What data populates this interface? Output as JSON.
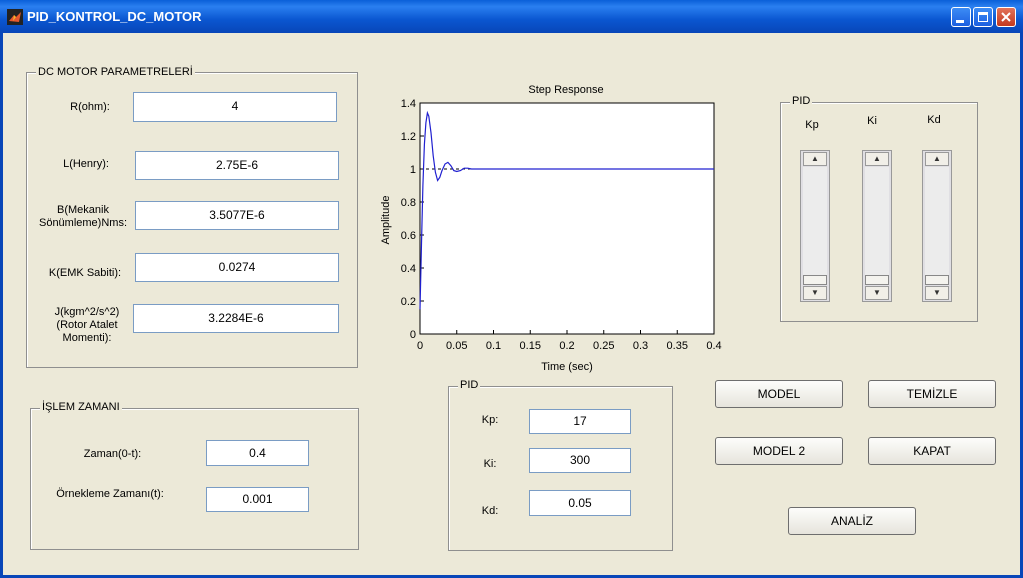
{
  "window": {
    "title": "PID_KONTROL_DC_MOTOR"
  },
  "motor_params": {
    "legend": "DC MOTOR PARAMETRELERİ",
    "rows": [
      {
        "label": "R(ohm):",
        "value": "4"
      },
      {
        "label": "L(Henry):",
        "value": "2.75E-6"
      },
      {
        "label": "B(Mekanik Sönümleme)Nms:",
        "value": "3.5077E-6"
      },
      {
        "label": "K(EMK Sabiti):",
        "value": "0.0274"
      },
      {
        "label": "J(kgm^2/s^2) (Rotor Atalet Momenti):",
        "value": "3.2284E-6"
      }
    ]
  },
  "time_panel": {
    "legend": "İŞLEM ZAMANI",
    "time_label": "Zaman(0-t):",
    "time_value": "0.4",
    "sample_label": "Örnekleme Zamanı(t):",
    "sample_value": "0.001"
  },
  "pid_inputs": {
    "legend": "PID",
    "kp_label": "Kp:",
    "kp_value": "17",
    "ki_label": "Ki:",
    "ki_value": "300",
    "kd_label": "Kd:",
    "kd_value": "0.05"
  },
  "pid_sliders": {
    "legend": "PID",
    "labels": [
      "Kp",
      "Ki",
      "Kd"
    ],
    "levels": [
      0.0,
      0.0,
      0.0
    ]
  },
  "buttons": {
    "model": "MODEL",
    "temizle": "TEMİZLE",
    "model2": "MODEL 2",
    "kapat": "KAPAT",
    "analiz": "ANALİZ"
  },
  "chart_data": {
    "type": "line",
    "title": "Step Response",
    "xlabel": "Time (sec)",
    "ylabel": "Amplitude",
    "xlim": [
      0,
      0.4
    ],
    "ylim": [
      0,
      1.4
    ],
    "xticks": [
      "0",
      "0.05",
      "0.1",
      "0.15",
      "0.2",
      "0.25",
      "0.3",
      "0.35",
      "0.4"
    ],
    "yticks": [
      "0",
      "0.2",
      "0.4",
      "0.6",
      "0.8",
      "1",
      "1.2",
      "1.4"
    ],
    "series": [
      {
        "x": [
          0,
          0.002,
          0.004,
          0.006,
          0.008,
          0.01,
          0.012,
          0.015,
          0.018,
          0.021,
          0.024,
          0.027,
          0.03,
          0.034,
          0.038,
          0.042,
          0.046,
          0.05,
          0.055,
          0.06,
          0.065,
          0.07,
          0.08,
          0.09,
          0.1,
          0.13,
          0.2,
          0.3,
          0.4
        ],
        "y": [
          0.15,
          0.55,
          0.9,
          1.15,
          1.28,
          1.34,
          1.32,
          1.22,
          1.08,
          0.98,
          0.93,
          0.95,
          0.99,
          1.03,
          1.04,
          1.02,
          0.99,
          0.985,
          0.99,
          1.005,
          1.005,
          1.0,
          1.0,
          1.0,
          1.0,
          1.0,
          1.0,
          1.0,
          1.0
        ]
      },
      {
        "x": [
          0,
          0.135
        ],
        "y": [
          1,
          1
        ]
      }
    ]
  }
}
